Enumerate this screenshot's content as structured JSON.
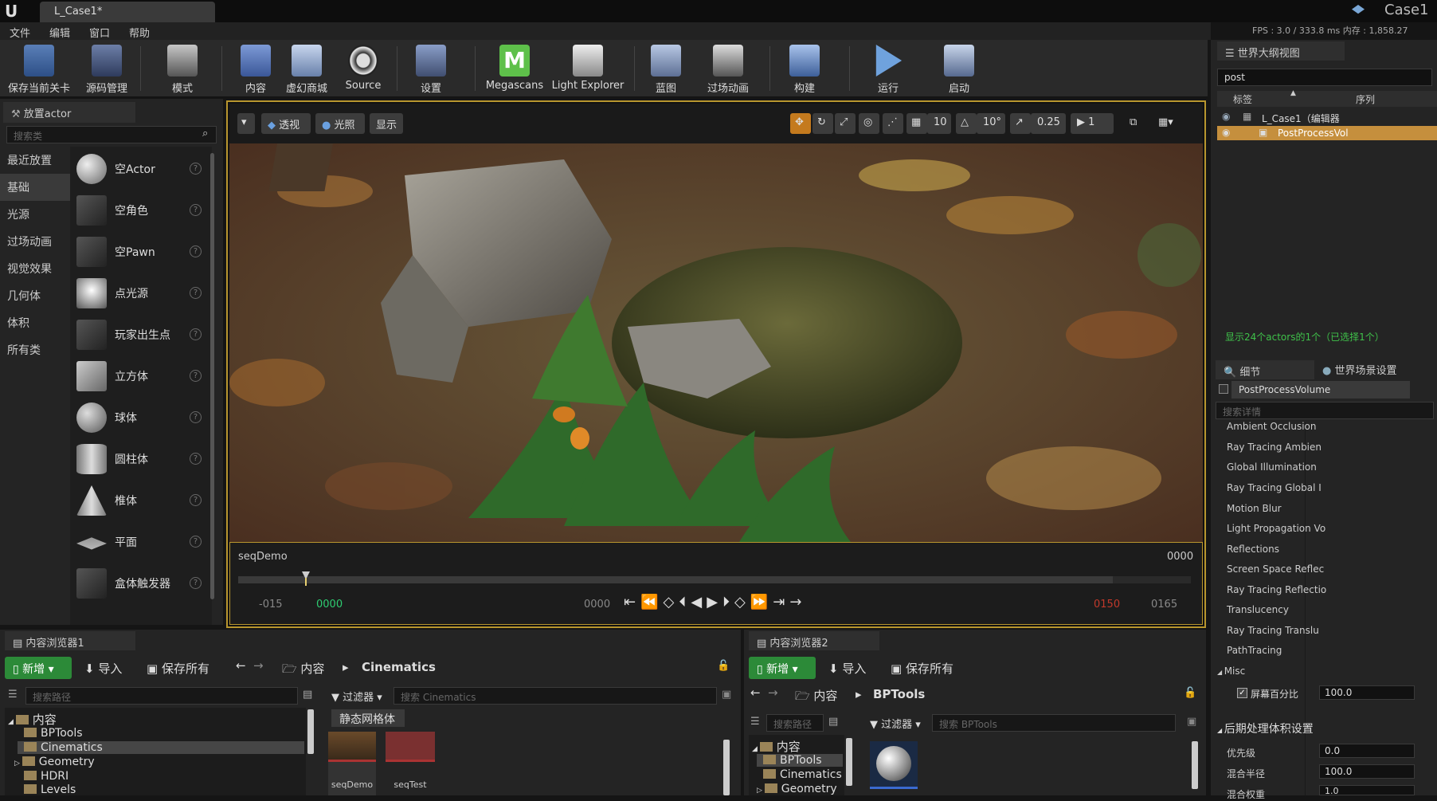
{
  "window": {
    "tab_title": "L_Case1*",
    "project_name": "Case1",
    "fps_text": "FPS : 3.0   / 333.8 ms   内存 : 1,858.27"
  },
  "menu": [
    "文件",
    "编辑",
    "窗口",
    "帮助"
  ],
  "toolbar": [
    "保存当前关卡",
    "源码管理",
    "模式",
    "内容",
    "虚幻商城",
    "Source",
    "设置",
    "Megascans",
    "Light Explorer",
    "蓝图",
    "过场动画",
    "构建",
    "运行",
    "启动"
  ],
  "place_actors": {
    "tab_title": "放置actor",
    "search_placeholder": "搜索类",
    "categories": [
      "最近放置",
      "基础",
      "光源",
      "过场动画",
      "视觉效果",
      "几何体",
      "体积",
      "所有类"
    ],
    "selected_category": "基础",
    "actors": [
      "空Actor",
      "空角色",
      "空Pawn",
      "点光源",
      "玩家出生点",
      "立方体",
      "球体",
      "圆柱体",
      "椎体",
      "平面",
      "盒体触发器"
    ]
  },
  "viewport": {
    "perspective_label": "透视",
    "lighting_label": "光照",
    "show_label": "显示",
    "grid_snap": "10",
    "rotation_snap": "10°",
    "scale_snap": "0.25",
    "camera_speed": "1"
  },
  "sequencer": {
    "name": "seqDemo",
    "frame_top_right": "0000",
    "start_outer": "-015",
    "start": "0000",
    "current": "0000",
    "end": "0150",
    "end_outer": "0165"
  },
  "outliner": {
    "tab_title": "世界大纲视图",
    "search_value": "post",
    "col_label": "标签",
    "col_type": "序列",
    "rows": [
      {
        "name": "L_Case1（编辑器",
        "selected": false
      },
      {
        "name": "PostProcessVol",
        "selected": true,
        "highlight": "Post"
      }
    ],
    "status": "显示24个actors的1个（已选择1个）"
  },
  "details": {
    "tab_details": "细节",
    "tab_world": "世界场景设置",
    "object_name": "PostProcessVolume",
    "search_placeholder": "搜索详情",
    "sections": [
      "Ambient Occlusion",
      "Ray Tracing Ambien",
      "Global Illumination",
      "Ray Tracing Global I",
      "Motion Blur",
      "Light Propagation Vo",
      "Reflections",
      "Screen Space Reflec",
      "Ray Tracing Reflectio",
      "Translucency",
      "Ray Tracing Translu",
      "PathTracing"
    ],
    "misc_label": "Misc",
    "screen_percentage_label": "屏幕百分比",
    "screen_percentage_value": "100.0",
    "postprocess_volume_settings": "后期处理体积设置",
    "priority_label": "优先级",
    "priority_value": "0.0",
    "blend_radius_label": "混合半径",
    "blend_radius_value": "100.0",
    "blend_weight_label": "混合权重",
    "blend_weight_value": "1.0"
  },
  "content_browser_1": {
    "tab_title": "内容浏览器1",
    "new_label": "新增",
    "import_label": "导入",
    "save_all_label": "保存所有",
    "path": [
      "内容",
      "Cinematics"
    ],
    "search_path_placeholder": "搜索路径",
    "filter_label": "过滤器",
    "search_placeholder": "搜索 Cinematics",
    "filter_chip": "静态网格体",
    "tree": [
      "内容",
      "BPTools",
      "Cinematics",
      "Geometry",
      "HDRI",
      "Levels"
    ],
    "assets": [
      "seqDemo",
      "seqTest"
    ]
  },
  "content_browser_2": {
    "tab_title": "内容浏览器2",
    "new_label": "新增",
    "import_label": "导入",
    "save_all_label": "保存所有",
    "path": [
      "内容",
      "BPTools"
    ],
    "search_path_placeholder": "搜索路径",
    "filter_label": "过滤器",
    "search_placeholder": "搜索 BPTools",
    "tree": [
      "内容",
      "BPTools",
      "Cinematics",
      "Geometry"
    ]
  },
  "colors": {
    "accent_green": "#2c8a38",
    "selection_orange": "#c58f3d",
    "timeline_red": "#c0392b",
    "timeline_green": "#2ecc71"
  }
}
